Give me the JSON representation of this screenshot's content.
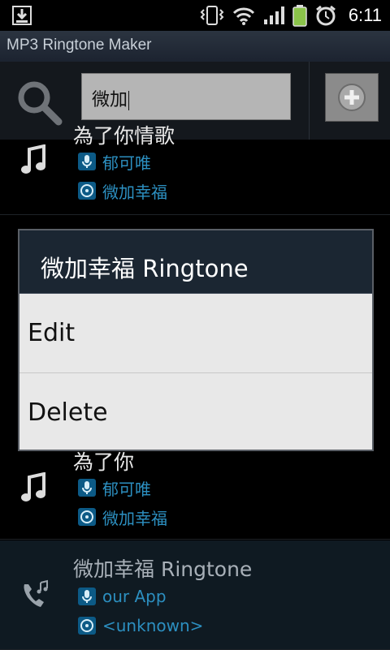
{
  "status_bar": {
    "time": "6:11"
  },
  "app": {
    "title": "MP3 Ringtone Maker"
  },
  "search": {
    "value": "微加"
  },
  "list": {
    "rows": [
      {
        "title": "為了你情歌",
        "artist": "郁可唯",
        "album": "微加幸福"
      },
      {
        "title": "為了你",
        "artist": "郁可唯",
        "album": "微加幸福"
      },
      {
        "title": "微加幸福 Ringtone",
        "artist": "our App",
        "album": "<unknown>"
      }
    ]
  },
  "dialog": {
    "title": "微加幸福 Ringtone",
    "items": [
      {
        "label": "Edit"
      },
      {
        "label": "Delete"
      }
    ]
  },
  "colors": {
    "accent": "#2c8fc0",
    "dialog_header": "#1b2632",
    "dialog_body": "#e8e8e8"
  }
}
